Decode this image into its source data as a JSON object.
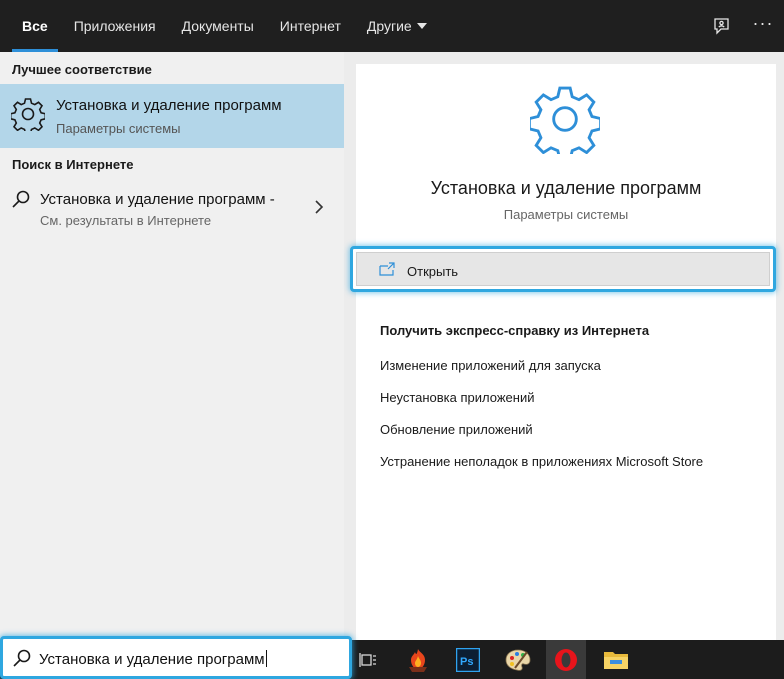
{
  "tabs": [
    {
      "label": "Все",
      "active": true
    },
    {
      "label": "Приложения"
    },
    {
      "label": "Документы"
    },
    {
      "label": "Интернет"
    },
    {
      "label": "Другие",
      "has_dropdown": true
    }
  ],
  "top_icons": [
    "feedback-icon",
    "more-options-icon"
  ],
  "left": {
    "best_match_title": "Лучшее соответствие",
    "best_match": {
      "title": "Установка и удаление программ",
      "subtitle": "Параметры системы",
      "icon": "gear-icon"
    },
    "web_title": "Поиск в Интернете",
    "web_item": {
      "title": "Установка и удаление программ -",
      "subtitle": "См. результаты в Интернете",
      "icon": "search-icon"
    }
  },
  "right": {
    "title": "Установка и удаление программ",
    "subtitle": "Параметры системы",
    "open_label": "Открыть",
    "help_title": "Получить экспресс-справку из Интернета",
    "help_links": [
      "Изменение приложений для запуска",
      "Неустановка приложений",
      "Обновление приложений",
      "Устранение неполадок в приложениях Microsoft Store"
    ]
  },
  "search": {
    "value": "Установка и удаление программ"
  },
  "taskbar_icons": [
    "task-view-icon",
    "app-icon",
    "photoshop-icon",
    "paint-palette-icon",
    "opera-icon",
    "file-explorer-icon"
  ],
  "colors": {
    "accent": "#2e8fd8",
    "highlight_border": "#2fa7e0",
    "selected_bg": "#b3d6e9"
  }
}
